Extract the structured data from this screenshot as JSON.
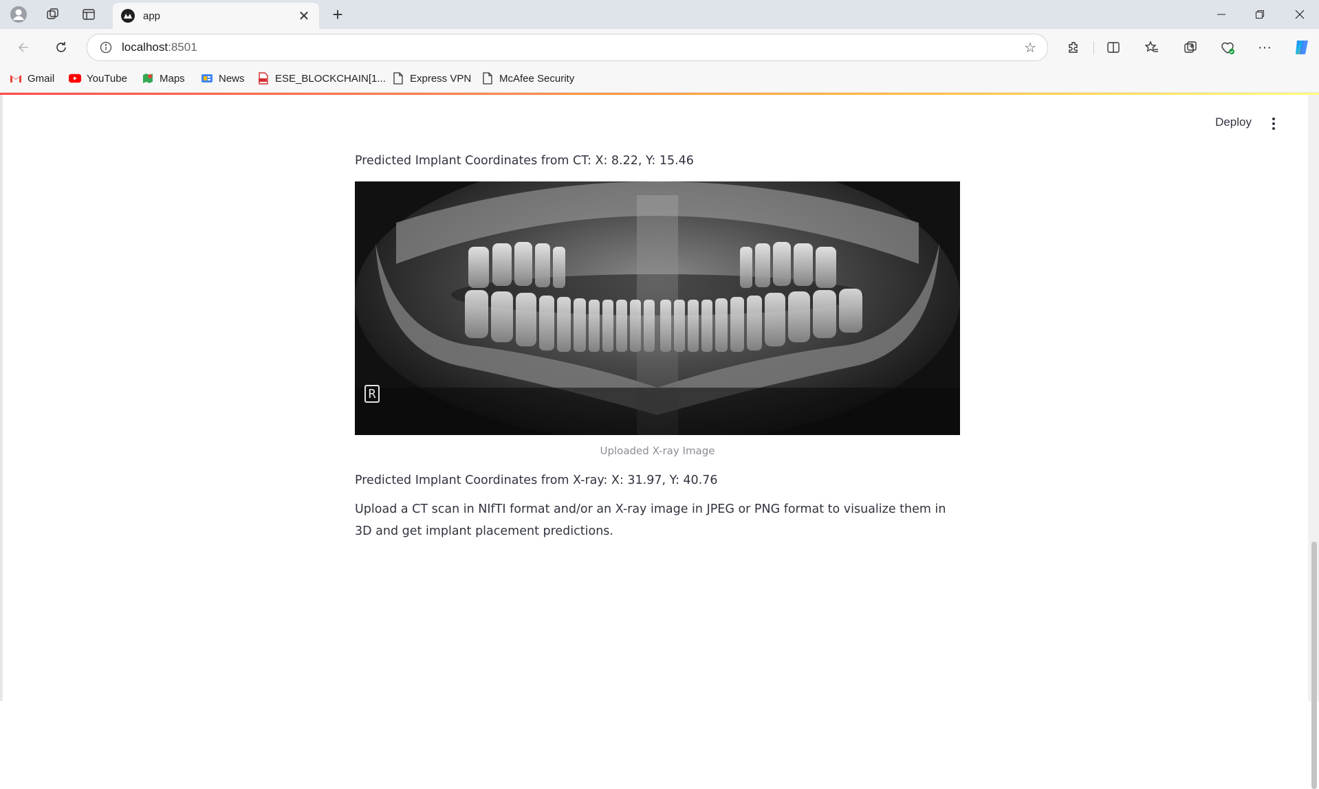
{
  "browser": {
    "tab_title": "app",
    "address": {
      "host": "localhost",
      "port": ":8501"
    },
    "bookmarks": [
      {
        "label": "Gmail",
        "icon": "gmail-icon"
      },
      {
        "label": "YouTube",
        "icon": "youtube-icon"
      },
      {
        "label": "Maps",
        "icon": "maps-icon"
      },
      {
        "label": "News",
        "icon": "news-icon"
      },
      {
        "label": "ESE_BLOCKCHAIN[1...",
        "icon": "pdf-icon"
      },
      {
        "label": "Express VPN",
        "icon": "page-icon"
      },
      {
        "label": "McAfee Security",
        "icon": "page-icon"
      }
    ]
  },
  "app": {
    "deploy_label": "Deploy",
    "ct_prediction": "Predicted Implant Coordinates from CT: X: 8.22, Y: 15.46",
    "image_caption": "Uploaded X-ray Image",
    "image_watermark": "R",
    "xray_prediction": "Predicted Implant Coordinates from X-ray: X: 31.97, Y: 40.76",
    "instructions": "Upload a CT scan in NIfTI format and/or an X-ray image in JPEG or PNG format to visualize them in 3D and get implant placement predictions."
  },
  "colors": {
    "accent_red": "#ff4b4b",
    "text": "#31333f",
    "caption": "#8a8c95"
  }
}
